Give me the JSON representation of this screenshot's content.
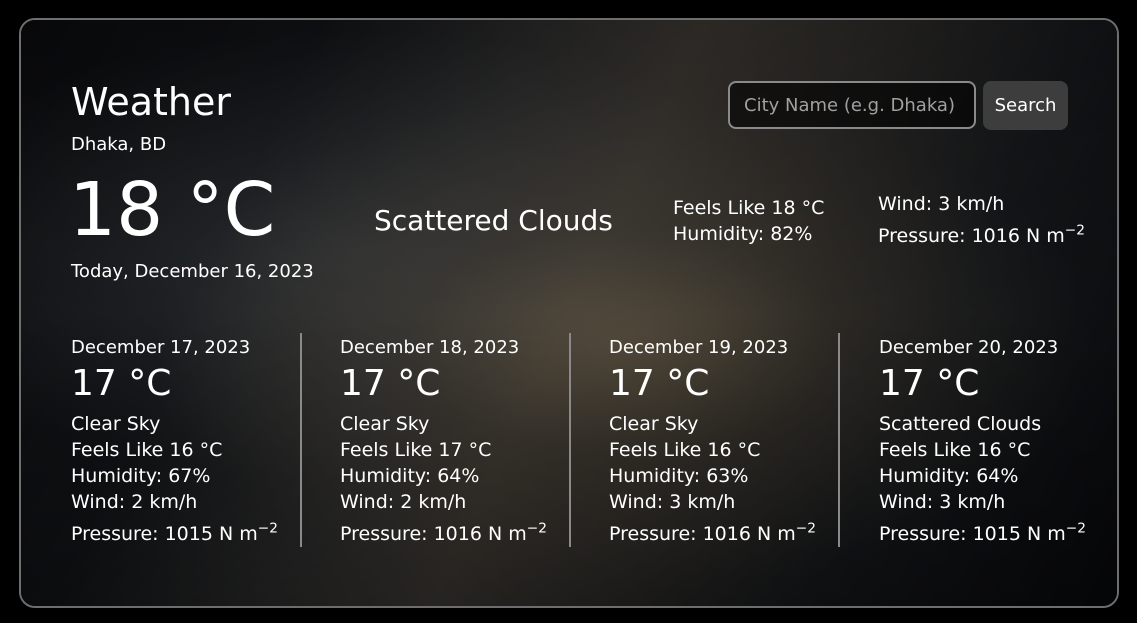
{
  "app": {
    "title": "Weather"
  },
  "search": {
    "placeholder": "City Name (e.g. Dhaka)",
    "value": "",
    "button_label": "Search"
  },
  "current": {
    "location": "Dhaka, BD",
    "temperature": "18 °C",
    "date": "Today, December 16, 2023",
    "condition": "Scattered Clouds",
    "feels_like": "Feels Like 18 °C",
    "humidity": "Humidity: 82%",
    "wind": "Wind: 3 km/h",
    "pressure": "Pressure: 1016 N m",
    "pressure_exp": "−2"
  },
  "forecast": [
    {
      "date": "December 17, 2023",
      "temperature": "17 °C",
      "condition": "Clear Sky",
      "feels_like": "Feels Like 16 °C",
      "humidity": "Humidity: 67%",
      "wind": "Wind: 2 km/h",
      "pressure": "Pressure: 1015 N m",
      "pressure_exp": "−2"
    },
    {
      "date": "December 18, 2023",
      "temperature": "17 °C",
      "condition": "Clear Sky",
      "feels_like": "Feels Like 17 °C",
      "humidity": "Humidity: 64%",
      "wind": "Wind: 2 km/h",
      "pressure": "Pressure: 1016 N m",
      "pressure_exp": "−2"
    },
    {
      "date": "December 19, 2023",
      "temperature": "17 °C",
      "condition": "Clear Sky",
      "feels_like": "Feels Like 16 °C",
      "humidity": "Humidity: 63%",
      "wind": "Wind: 3 km/h",
      "pressure": "Pressure: 1016 N m",
      "pressure_exp": "−2"
    },
    {
      "date": "December 20, 2023",
      "temperature": "17 °C",
      "condition": "Scattered Clouds",
      "feels_like": "Feels Like 16 °C",
      "humidity": "Humidity: 64%",
      "wind": "Wind: 3 km/h",
      "pressure": "Pressure: 1015 N m",
      "pressure_exp": "−2"
    }
  ],
  "colors": {
    "page_background": "#000000",
    "card_border": "#6e6e6e",
    "text": "#ffffff",
    "button_background": "#3d3d3d",
    "divider": "#8a8a8a"
  }
}
